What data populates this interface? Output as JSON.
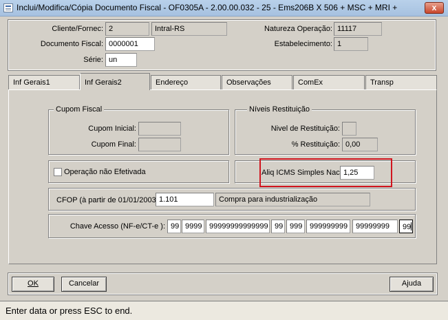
{
  "window": {
    "title": "Inclui/Modifica/Cópia Documento Fiscal - OF0305A - 2.00.00.032 - 25 - Ems206B X 506 + MSC + MRI +",
    "close_label": "x"
  },
  "header": {
    "cliente_label": "Cliente/Fornec:",
    "cliente_code": "2",
    "cliente_name": "Intral-RS",
    "documento_label": "Documento Fiscal:",
    "documento_value": "0000001",
    "serie_label": "Série:",
    "serie_value": "un",
    "natureza_label": "Natureza Operação:",
    "natureza_value": "11117",
    "estabelecimento_label": "Estabelecimento:",
    "estabelecimento_value": "1"
  },
  "tabs": [
    {
      "label": "Inf Gerais1",
      "active": false
    },
    {
      "label": "Inf Gerais2",
      "active": true
    },
    {
      "label": "Endereço",
      "active": false
    },
    {
      "label": "Observações",
      "active": false
    },
    {
      "label": "ComEx",
      "active": false
    },
    {
      "label": "Transp",
      "active": false
    }
  ],
  "cupom": {
    "title": "Cupom Fiscal",
    "inicial_label": "Cupom Inicial:",
    "inicial_value": "",
    "final_label": "Cupom Final:",
    "final_value": ""
  },
  "restituicao": {
    "title": "Níveis Restituição",
    "nivel_label": "Nivel de Restituição:",
    "nivel_value": "",
    "percent_label": "% Restituição:",
    "percent_value": "0,00"
  },
  "operacao": {
    "label": "Operação não Efetivada",
    "checked": false
  },
  "aliq": {
    "label": "Aliq ICMS Simples Nac:",
    "value": "1,25"
  },
  "cfop": {
    "label": "CFOP (à partir de 01/01/2003)",
    "code": "1.101",
    "description": "Compra para industrialização"
  },
  "chave": {
    "label": "Chave Acesso (NF-e/CT-e ):",
    "segments": [
      "99",
      "9999",
      "99999999999999",
      "99",
      "999",
      "999999999",
      "99999999",
      "99"
    ]
  },
  "buttons": {
    "ok": "OK",
    "cancelar": "Cancelar",
    "ajuda": "Ajuda"
  },
  "status": {
    "text": "Enter data or press ESC to end."
  },
  "colors": {
    "highlight": "#d0141e",
    "titlebar": "#b9d1ea",
    "background": "#d4d0c8"
  }
}
